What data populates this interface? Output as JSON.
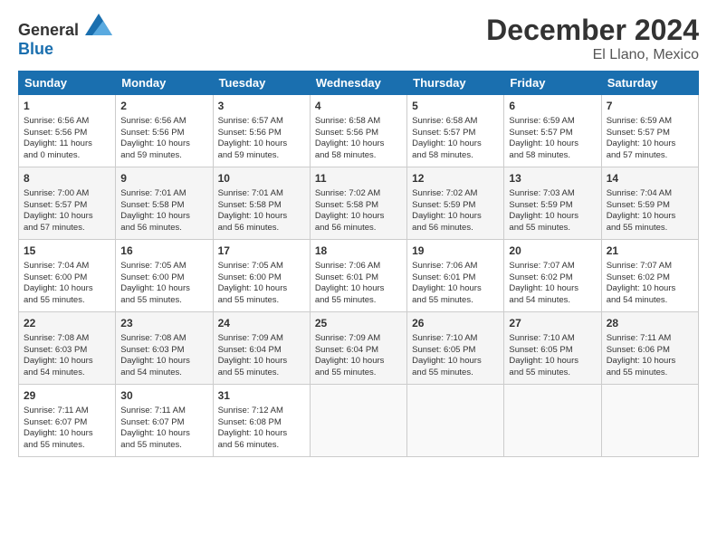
{
  "header": {
    "logo_general": "General",
    "logo_blue": "Blue",
    "month": "December 2024",
    "location": "El Llano, Mexico"
  },
  "days_of_week": [
    "Sunday",
    "Monday",
    "Tuesday",
    "Wednesday",
    "Thursday",
    "Friday",
    "Saturday"
  ],
  "weeks": [
    [
      {
        "day": "1",
        "info": "Sunrise: 6:56 AM\nSunset: 5:56 PM\nDaylight: 11 hours\nand 0 minutes."
      },
      {
        "day": "2",
        "info": "Sunrise: 6:56 AM\nSunset: 5:56 PM\nDaylight: 10 hours\nand 59 minutes."
      },
      {
        "day": "3",
        "info": "Sunrise: 6:57 AM\nSunset: 5:56 PM\nDaylight: 10 hours\nand 59 minutes."
      },
      {
        "day": "4",
        "info": "Sunrise: 6:58 AM\nSunset: 5:56 PM\nDaylight: 10 hours\nand 58 minutes."
      },
      {
        "day": "5",
        "info": "Sunrise: 6:58 AM\nSunset: 5:57 PM\nDaylight: 10 hours\nand 58 minutes."
      },
      {
        "day": "6",
        "info": "Sunrise: 6:59 AM\nSunset: 5:57 PM\nDaylight: 10 hours\nand 58 minutes."
      },
      {
        "day": "7",
        "info": "Sunrise: 6:59 AM\nSunset: 5:57 PM\nDaylight: 10 hours\nand 57 minutes."
      }
    ],
    [
      {
        "day": "8",
        "info": "Sunrise: 7:00 AM\nSunset: 5:57 PM\nDaylight: 10 hours\nand 57 minutes."
      },
      {
        "day": "9",
        "info": "Sunrise: 7:01 AM\nSunset: 5:58 PM\nDaylight: 10 hours\nand 56 minutes."
      },
      {
        "day": "10",
        "info": "Sunrise: 7:01 AM\nSunset: 5:58 PM\nDaylight: 10 hours\nand 56 minutes."
      },
      {
        "day": "11",
        "info": "Sunrise: 7:02 AM\nSunset: 5:58 PM\nDaylight: 10 hours\nand 56 minutes."
      },
      {
        "day": "12",
        "info": "Sunrise: 7:02 AM\nSunset: 5:59 PM\nDaylight: 10 hours\nand 56 minutes."
      },
      {
        "day": "13",
        "info": "Sunrise: 7:03 AM\nSunset: 5:59 PM\nDaylight: 10 hours\nand 55 minutes."
      },
      {
        "day": "14",
        "info": "Sunrise: 7:04 AM\nSunset: 5:59 PM\nDaylight: 10 hours\nand 55 minutes."
      }
    ],
    [
      {
        "day": "15",
        "info": "Sunrise: 7:04 AM\nSunset: 6:00 PM\nDaylight: 10 hours\nand 55 minutes."
      },
      {
        "day": "16",
        "info": "Sunrise: 7:05 AM\nSunset: 6:00 PM\nDaylight: 10 hours\nand 55 minutes."
      },
      {
        "day": "17",
        "info": "Sunrise: 7:05 AM\nSunset: 6:00 PM\nDaylight: 10 hours\nand 55 minutes."
      },
      {
        "day": "18",
        "info": "Sunrise: 7:06 AM\nSunset: 6:01 PM\nDaylight: 10 hours\nand 55 minutes."
      },
      {
        "day": "19",
        "info": "Sunrise: 7:06 AM\nSunset: 6:01 PM\nDaylight: 10 hours\nand 55 minutes."
      },
      {
        "day": "20",
        "info": "Sunrise: 7:07 AM\nSunset: 6:02 PM\nDaylight: 10 hours\nand 54 minutes."
      },
      {
        "day": "21",
        "info": "Sunrise: 7:07 AM\nSunset: 6:02 PM\nDaylight: 10 hours\nand 54 minutes."
      }
    ],
    [
      {
        "day": "22",
        "info": "Sunrise: 7:08 AM\nSunset: 6:03 PM\nDaylight: 10 hours\nand 54 minutes."
      },
      {
        "day": "23",
        "info": "Sunrise: 7:08 AM\nSunset: 6:03 PM\nDaylight: 10 hours\nand 54 minutes."
      },
      {
        "day": "24",
        "info": "Sunrise: 7:09 AM\nSunset: 6:04 PM\nDaylight: 10 hours\nand 55 minutes."
      },
      {
        "day": "25",
        "info": "Sunrise: 7:09 AM\nSunset: 6:04 PM\nDaylight: 10 hours\nand 55 minutes."
      },
      {
        "day": "26",
        "info": "Sunrise: 7:10 AM\nSunset: 6:05 PM\nDaylight: 10 hours\nand 55 minutes."
      },
      {
        "day": "27",
        "info": "Sunrise: 7:10 AM\nSunset: 6:05 PM\nDaylight: 10 hours\nand 55 minutes."
      },
      {
        "day": "28",
        "info": "Sunrise: 7:11 AM\nSunset: 6:06 PM\nDaylight: 10 hours\nand 55 minutes."
      }
    ],
    [
      {
        "day": "29",
        "info": "Sunrise: 7:11 AM\nSunset: 6:07 PM\nDaylight: 10 hours\nand 55 minutes."
      },
      {
        "day": "30",
        "info": "Sunrise: 7:11 AM\nSunset: 6:07 PM\nDaylight: 10 hours\nand 55 minutes."
      },
      {
        "day": "31",
        "info": "Sunrise: 7:12 AM\nSunset: 6:08 PM\nDaylight: 10 hours\nand 56 minutes."
      },
      {
        "day": "",
        "info": ""
      },
      {
        "day": "",
        "info": ""
      },
      {
        "day": "",
        "info": ""
      },
      {
        "day": "",
        "info": ""
      }
    ]
  ]
}
